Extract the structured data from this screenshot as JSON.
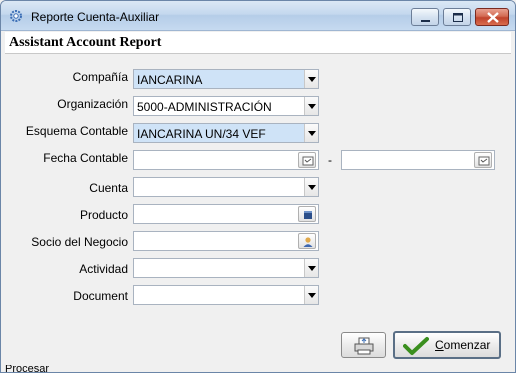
{
  "window": {
    "title": "Reporte Cuenta-Auxiliar",
    "controls": {
      "minimize_icon": "minimize-icon",
      "maximize_icon": "maximize-icon",
      "close_icon": "close-icon"
    }
  },
  "header": {
    "title": "Assistant Account Report"
  },
  "form": {
    "fields": [
      {
        "label": "Compañía",
        "value": "IANCARINA",
        "type": "combo",
        "required": true
      },
      {
        "label": "Organización",
        "value": "5000-ADMINISTRACIÓN",
        "type": "combo",
        "required": false
      },
      {
        "label": "Esquema Contable",
        "value": "IANCARINA UN/34 VEF",
        "type": "combo",
        "required": true
      },
      {
        "label": "Fecha Contable",
        "value_from": "",
        "value_to": "",
        "separator": "-",
        "type": "date-range"
      },
      {
        "label": "Cuenta",
        "value": "",
        "type": "combo"
      },
      {
        "label": "Producto",
        "value": "",
        "type": "search"
      },
      {
        "label": "Socio del Negocio",
        "value": "",
        "type": "search"
      },
      {
        "label": "Actividad",
        "value": "",
        "type": "combo"
      },
      {
        "label": "Document",
        "value": "",
        "type": "combo"
      }
    ]
  },
  "buttons": {
    "print_icon": "printer-icon",
    "start_label": "Comenzar",
    "start_icon": "checkmark-icon"
  },
  "statusbar": {
    "text": "Procesar"
  },
  "colors": {
    "required_field": "#cfe3f7",
    "titlebar": "#c4d8ee",
    "close_button": "#c0432c"
  }
}
